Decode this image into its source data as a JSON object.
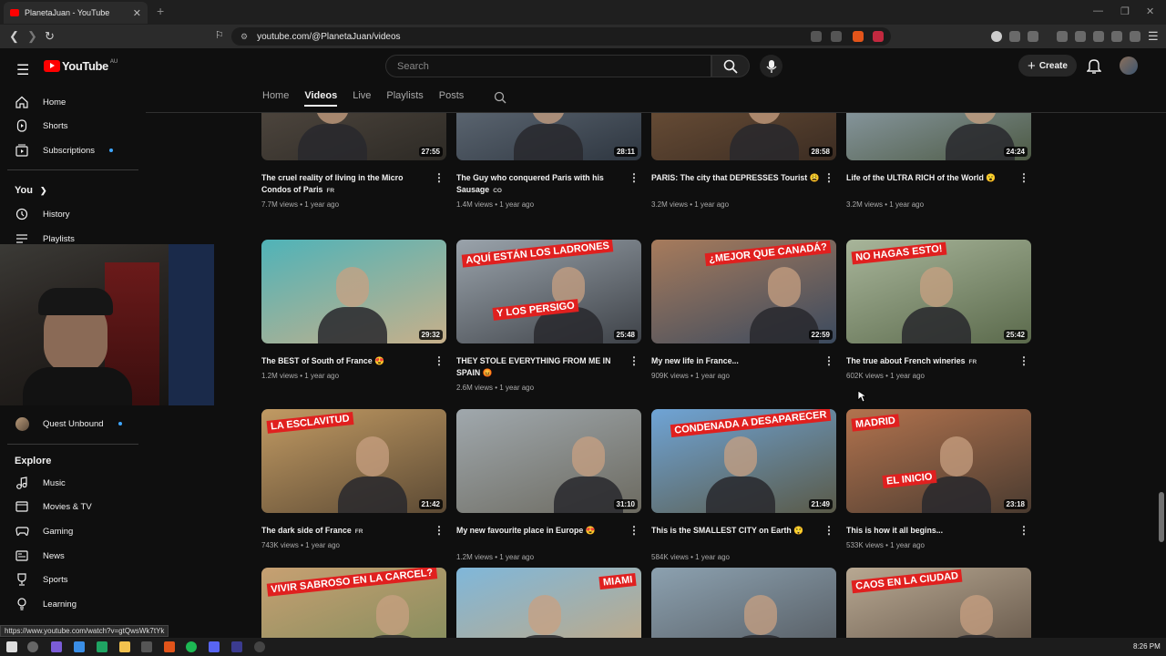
{
  "browser": {
    "tab_title": "PlanetaJuan - YouTube",
    "new_tab": "+",
    "url": "youtube.com/@PlanetaJuan/videos",
    "status_url": "https://www.youtube.com/watch?v=gtQwsWk7tYk"
  },
  "header": {
    "logo": "YouTube",
    "region": "AU",
    "search_placeholder": "Search",
    "create_label": "Create"
  },
  "sidebar": {
    "main": [
      {
        "label": "Home",
        "icon": "home-icon"
      },
      {
        "label": "Shorts",
        "icon": "shorts-icon"
      },
      {
        "label": "Subscriptions",
        "icon": "subscriptions-icon"
      }
    ],
    "you_label": "You",
    "you_items": [
      {
        "label": "History",
        "icon": "history-icon"
      },
      {
        "label": "Playlists",
        "icon": "playlists-icon"
      }
    ],
    "subscription": "Quest Unbound",
    "explore_label": "Explore",
    "explore_items": [
      {
        "label": "Music",
        "icon": "music-icon"
      },
      {
        "label": "Movies & TV",
        "icon": "movies-icon"
      },
      {
        "label": "Gaming",
        "icon": "gaming-icon"
      },
      {
        "label": "News",
        "icon": "news-icon"
      },
      {
        "label": "Sports",
        "icon": "sports-icon"
      },
      {
        "label": "Learning",
        "icon": "learning-icon"
      }
    ]
  },
  "channel_tabs": [
    "Home",
    "Videos",
    "Live",
    "Playlists",
    "Posts"
  ],
  "active_tab": "Videos",
  "videos": [
    {
      "title": "The cruel reality of living in the Micro Condos of Paris",
      "badge": "FR",
      "views": "7.7M views",
      "age": "1 year ago",
      "duration": "27:55"
    },
    {
      "title": "The Guy who conquered Paris with his Sausage",
      "badge": "CO",
      "views": "1.4M views",
      "age": "1 year ago",
      "duration": "28:11"
    },
    {
      "title": "PARIS: The city that DEPRESSES Tourist 😩",
      "badge": "",
      "views": "3.2M views",
      "age": "1 year ago",
      "duration": "28:58"
    },
    {
      "title": "Life of the ULTRA RICH of the World 😮",
      "badge": "",
      "views": "3.2M views",
      "age": "1 year ago",
      "duration": "24:24"
    },
    {
      "title": "The BEST of South of France 😍",
      "badge": "",
      "views": "1.2M views",
      "age": "1 year ago",
      "duration": "29:32"
    },
    {
      "title": "THEY STOLE EVERYTHING FROM ME IN SPAIN 😡",
      "badge": "",
      "views": "2.6M views",
      "age": "1 year ago",
      "duration": "25:48",
      "overlay": [
        "AQUÍ ESTÁN LOS LADRONES",
        "Y LOS PERSIGO"
      ]
    },
    {
      "title": "My new life in France...",
      "badge": "",
      "views": "909K views",
      "age": "1 year ago",
      "duration": "22:59",
      "overlay": [
        "¿MEJOR QUE CANADÁ?"
      ]
    },
    {
      "title": "The true about French wineries",
      "badge": "FR",
      "views": "602K views",
      "age": "1 year ago",
      "duration": "25:42",
      "overlay": [
        "NO HAGAS ESTO!"
      ]
    },
    {
      "title": "The dark side of France",
      "badge": "FR",
      "views": "743K views",
      "age": "1 year ago",
      "duration": "21:42",
      "overlay": [
        "LA ESCLAVITUD"
      ]
    },
    {
      "title": "My new favourite place in Europe 😍",
      "badge": "",
      "views": "1.2M views",
      "age": "1 year ago",
      "duration": "31:10"
    },
    {
      "title": "This is the SMALLEST CITY on Earth 😲",
      "badge": "",
      "views": "584K views",
      "age": "1 year ago",
      "duration": "21:49",
      "overlay": [
        "CONDENADA A DESAPARECER"
      ]
    },
    {
      "title": "This is how it all begins...",
      "badge": "",
      "views": "533K views",
      "age": "1 year ago",
      "duration": "23:18",
      "overlay": [
        "MADRID",
        "EL INICIO"
      ]
    },
    {
      "title": "",
      "badge": "",
      "views": "",
      "age": "",
      "duration": "",
      "overlay": [
        "VIVIR SABROSO EN LA CARCEL?"
      ]
    },
    {
      "title": "",
      "badge": "",
      "views": "",
      "age": "",
      "duration": "",
      "overlay": [
        "MIAMI"
      ]
    },
    {
      "title": "",
      "badge": "",
      "views": "",
      "age": "",
      "duration": ""
    },
    {
      "title": "",
      "badge": "",
      "views": "",
      "age": "",
      "duration": "",
      "overlay": [
        "CAOS EN LA CIUDAD"
      ]
    }
  ],
  "taskbar": {
    "time": "8:26 PM"
  },
  "colors": {
    "accent": "#ff0000",
    "background": "#0f0f0f",
    "link_dot": "#3ea6ff"
  }
}
